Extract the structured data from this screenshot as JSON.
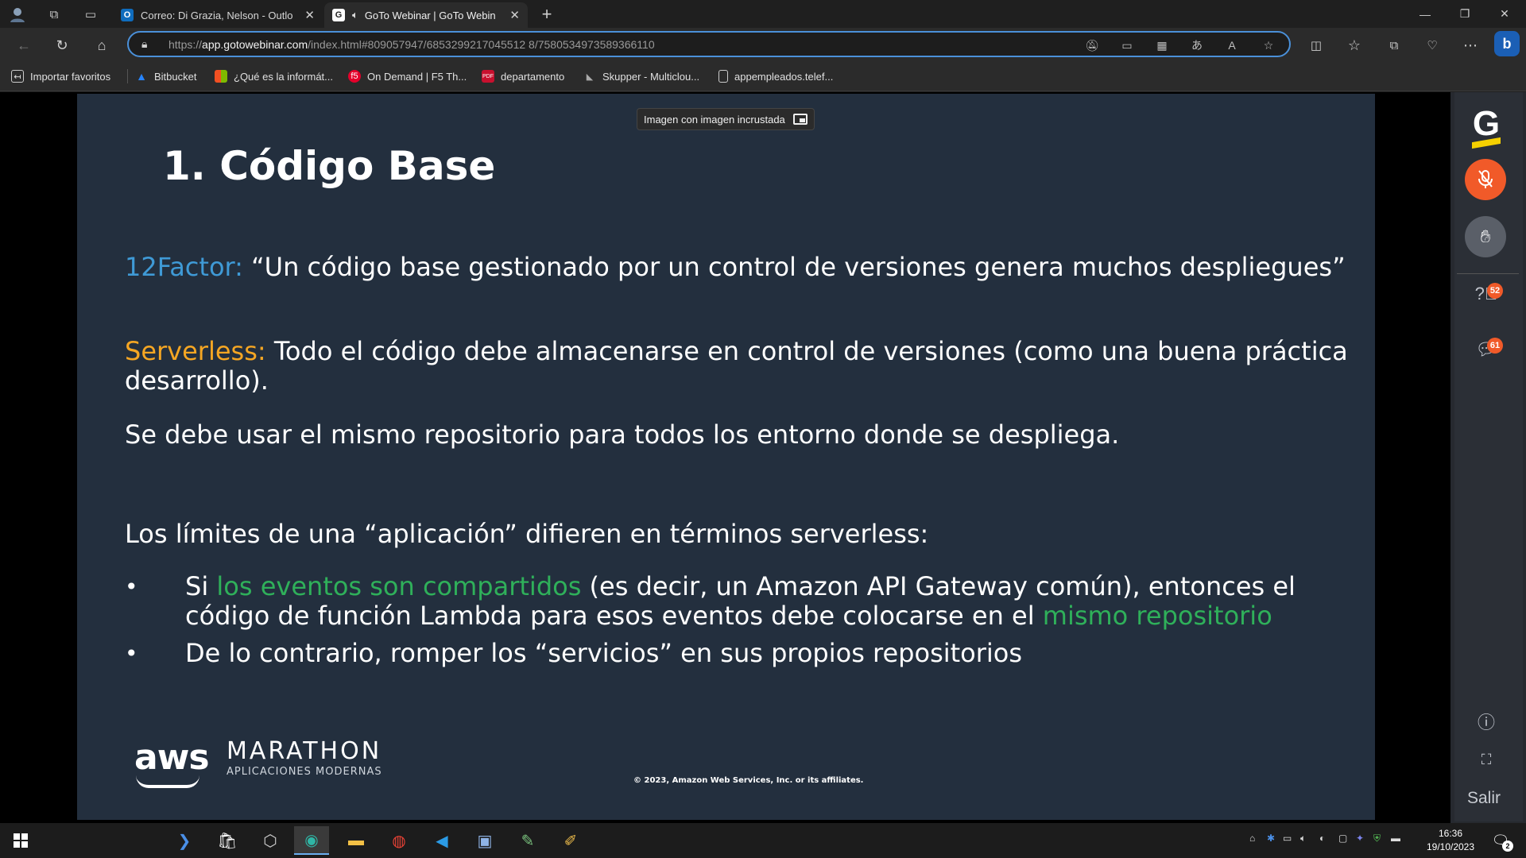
{
  "browser": {
    "tabs": [
      {
        "label": "Correo: Di Grazia, Nelson - Outlo",
        "favicon": "outlook-icon",
        "active": false
      },
      {
        "label": "GoTo Webinar | GoTo Webin",
        "favicon": "goto-icon",
        "active": true
      }
    ],
    "new_tab": "+",
    "url_prefix": "https://",
    "url_host": "app.gotowebinar.com",
    "url_path": "/index.html#809057947/6853299217045512 8/7580534973589366110",
    "favorites": [
      {
        "label": "Importar favoritos",
        "icon": "import-icon"
      },
      {
        "label": "Bitbucket",
        "icon": "bitbucket-icon"
      },
      {
        "label": "¿Qué es la informát...",
        "icon": "microsoft-icon"
      },
      {
        "label": "On Demand | F5 Th...",
        "icon": "f5-icon"
      },
      {
        "label": "departamento",
        "icon": "pdf-icon"
      },
      {
        "label": "Skupper - Multiclou...",
        "icon": "skupper-icon"
      },
      {
        "label": "appempleados.telef...",
        "icon": "page-icon"
      }
    ]
  },
  "pip_tooltip": "Imagen con imagen incrustada",
  "slide": {
    "title": "1. Código Base",
    "factor_label": "12Factor:",
    "factor_text": " “Un código base gestionado por un control de versiones genera muchos despliegues”",
    "serverless_label": "Serverless:",
    "serverless_text_1": " Todo el código debe almacenarse en control de versiones (como una buena práctica de",
    "serverless_text_2": "desarrollo).",
    "repo_text": "Se debe usar el mismo repositorio para todos los entorno donde se despliega.",
    "limits_text": "Los límites de una “aplicación” difieren en términos serverless:",
    "bullet_symbol": "•",
    "b1_pre": "Si ",
    "b1_green": "los eventos son compartidos",
    "b1_mid": " (es decir, un Amazon API Gateway común), entonces el",
    "b1_line2": "código de función Lambda para esos eventos debe colocarse en el ",
    "b1_green2": "mismo repositorio",
    "b2_text": "De lo contrario, romper los “servicios” en sus propios repositorios",
    "aws": "aws",
    "marathon": "MARATHON",
    "apps": "APLICACIONES MODERNAS",
    "copyright": "© 2023, Amazon Web Services, Inc. or its affiliates."
  },
  "goto_panel": {
    "logo": "G",
    "questions_count": "52",
    "chat_count": "61",
    "exit_label": "Salir"
  },
  "taskbar": {
    "time": "16:36",
    "date": "19/10/2023",
    "notifications": "2"
  },
  "colors": {
    "slide_bg": "#232f3e",
    "factor_blue": "#3f9ad6",
    "serverless_orange": "#f5a623",
    "highlight_green": "#2fb05a",
    "goto_orange": "#f15a29",
    "omnibox_border": "#4a90d9"
  }
}
